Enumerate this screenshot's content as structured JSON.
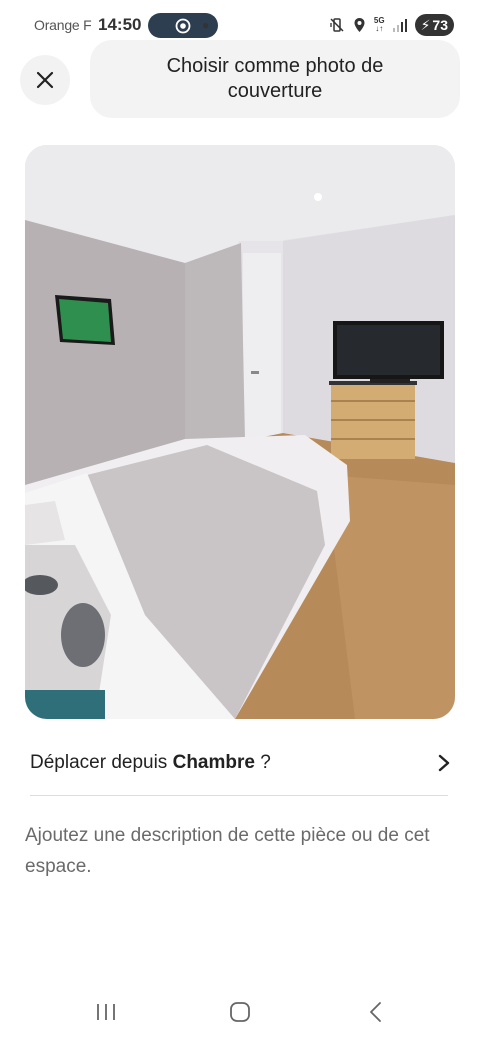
{
  "status_bar": {
    "carrier": "Orange F",
    "time": "14:50",
    "battery": "73",
    "network": "5G"
  },
  "header": {
    "close_icon": "close-icon",
    "title": "Choisir comme photo de couverture"
  },
  "photo": {
    "subject": "bedroom-photo"
  },
  "move_row": {
    "prefix": "Déplacer depuis ",
    "room": "Chambre",
    "suffix": " ?",
    "icon": "chevron-right-icon"
  },
  "description": {
    "placeholder": "Ajoutez une description de cette pièce ou de cet espace."
  },
  "nav": {
    "recents_icon": "recent-apps-icon",
    "home_icon": "home-icon",
    "back_icon": "back-icon"
  },
  "colors": {
    "text": "#222222",
    "muted": "#6a6a6a",
    "pill_bg": "#f3f3f3",
    "divider": "#dddddd"
  }
}
